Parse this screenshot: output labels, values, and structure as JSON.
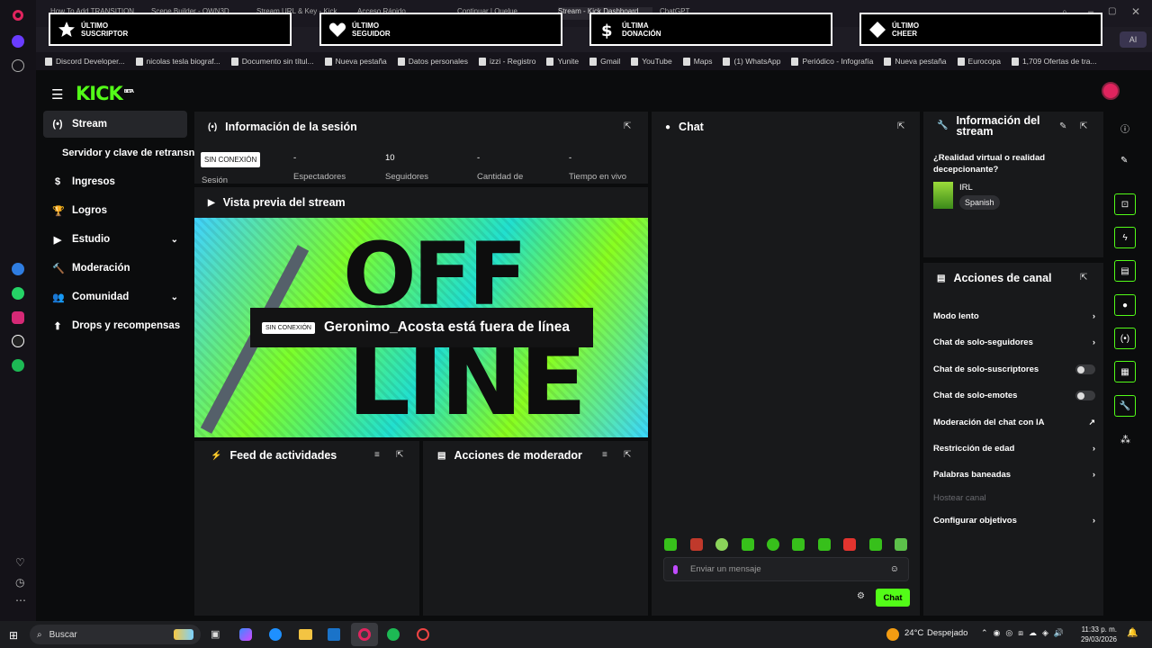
{
  "browser": {
    "tabs": [
      "How To Add TRANSITION...",
      "Scene Builder - OWN3D...",
      "Stream URL & Key - Kick",
      "Acceso Rápido",
      "Continuar | Quelue",
      "Stream - Kick Dashboard",
      "ChatGPT"
    ],
    "bookmarks": [
      "Discord Developer...",
      "nicolas tesla biograf...",
      "Documento sin títul...",
      "Nueva pestaña",
      "Datos personales",
      "izzi - Registro",
      "Yunite",
      "Gmail",
      "YouTube",
      "Maps",
      "(1) WhatsApp",
      "Periódico - Infografía",
      "Nueva pestaña",
      "Eurocopa",
      "1,709 Ofertas de tra..."
    ],
    "ai_label": "AI"
  },
  "alerts": [
    {
      "line1": "ÚLTIMO",
      "line2": "SUSCRIPTOR",
      "icon": "star-icon"
    },
    {
      "line1": "ÚLTIMO",
      "line2": "SEGUIDOR",
      "icon": "heart-icon"
    },
    {
      "line1": "ÚLTIMA",
      "line2": "DONACIÓN",
      "icon": "dollar-icon"
    },
    {
      "line1": "ÚLTIMO",
      "line2": "CHEER",
      "icon": "diamond-icon"
    }
  ],
  "app": {
    "logo": "KICK",
    "logo_badge": "BETA",
    "nav": [
      {
        "label": "Stream",
        "icon": "(•)"
      },
      {
        "label": "Servidor y clave de retransn",
        "icon": ""
      },
      {
        "label": "Ingresos",
        "icon": "$"
      },
      {
        "label": "Logros",
        "icon": "🏆"
      },
      {
        "label": "Estudio",
        "icon": "▶"
      },
      {
        "label": "Moderación",
        "icon": "🔨"
      },
      {
        "label": "Comunidad",
        "icon": "👥"
      },
      {
        "label": "Drops y recompensas",
        "icon": "⬆"
      }
    ],
    "session": {
      "title": "Información de la sesión",
      "badge": "SIN CONEXIÓN",
      "badge_sub": "Sesión",
      "stats": [
        {
          "value": "-",
          "label": "Espectadores"
        },
        {
          "value": "10",
          "label": "Seguidores"
        },
        {
          "value": "-",
          "label": "Cantidad de"
        },
        {
          "value": "-",
          "label": "Tiempo en vivo"
        }
      ]
    },
    "preview": {
      "title": "Vista previa del stream",
      "badge": "SIN CONEXIÓN",
      "message": "Geronimo_Acosta está fuera de línea",
      "big1": "OFF",
      "big2": "LINE"
    },
    "feed": {
      "title": "Feed de actividades"
    },
    "modactions": {
      "title": "Acciones de moderador"
    },
    "chat": {
      "title": "Chat",
      "placeholder": "Enviar un mensaje",
      "send": "Chat"
    },
    "streaminfo": {
      "title": "Información del stream",
      "stream_title": "¿Realidad virtual o realidad decepcionante?",
      "category": "IRL",
      "language": "Spanish"
    },
    "channel": {
      "title": "Acciones de canal",
      "items": [
        {
          "label": "Modo lento",
          "control": "arrow"
        },
        {
          "label": "Chat de solo-seguidores",
          "control": "arrow"
        },
        {
          "label": "Chat de solo-suscriptores",
          "control": "toggle"
        },
        {
          "label": "Chat de solo-emotes",
          "control": "toggle"
        },
        {
          "label": "Moderación del chat con IA",
          "control": "external"
        },
        {
          "label": "Restricción de edad",
          "control": "arrow"
        },
        {
          "label": "Palabras baneadas",
          "control": "arrow"
        },
        {
          "label": "Hostear canal",
          "control": "none"
        },
        {
          "label": "Configurar objetivos",
          "control": "arrow"
        }
      ]
    }
  },
  "taskbar": {
    "search": "Buscar",
    "weather": "24°C",
    "weather_desc": "Despejado",
    "time": "11:33 p. m.",
    "date": "29/03/2026"
  },
  "colors": {
    "accent": "#53fc18",
    "panel": "#18191b",
    "bg": "#0b0c0d"
  }
}
